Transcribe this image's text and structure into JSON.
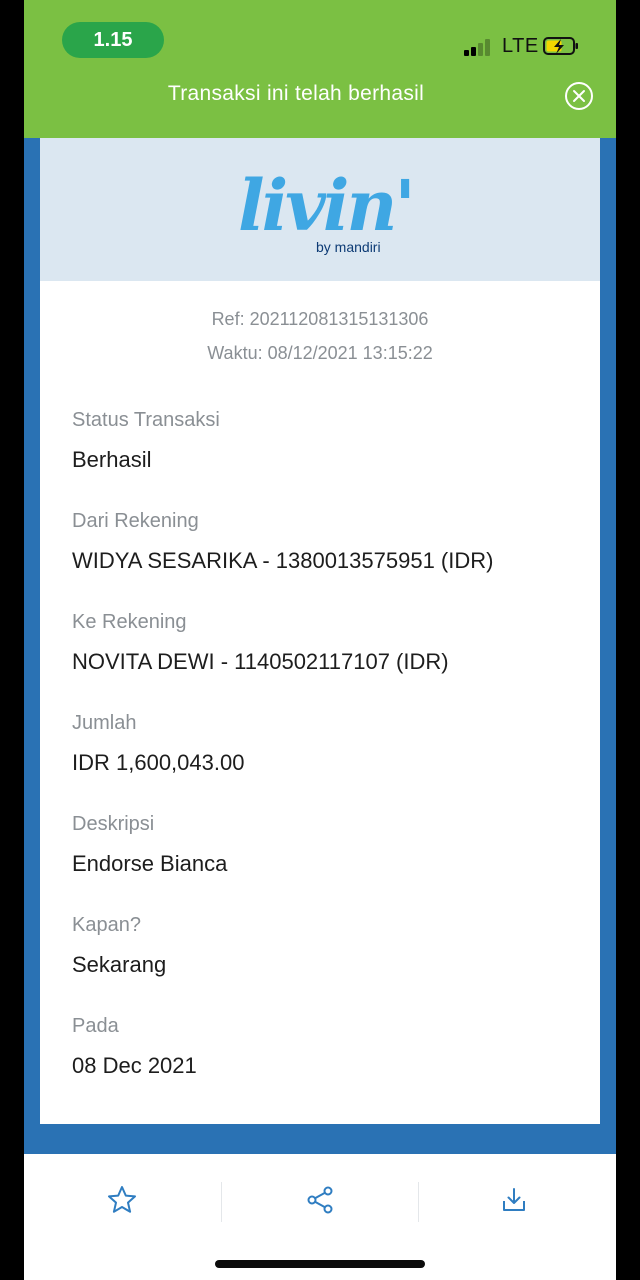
{
  "status_bar": {
    "time": "1.15",
    "network": "LTE",
    "icons": [
      "signal-icon",
      "battery-charging-icon"
    ]
  },
  "header": {
    "title": "Transaksi ini telah berhasil",
    "close_icon": "close-circle-icon"
  },
  "logo": {
    "brand": "livin'",
    "sub": "by mandiri",
    "colors": {
      "brand_blue": "#3fa7e3",
      "accent_yellow": "#f5b800",
      "navy": "#0d3b75"
    }
  },
  "receipt": {
    "ref": "Ref: 20211208131513130​6",
    "time": "Waktu: 08/12/2021 13:15:22",
    "fields": [
      {
        "label": "Status Transaksi",
        "value": "Berhasil"
      },
      {
        "label": "Dari Rekening",
        "value": "WIDYA SESARIKA - 1380013575951 (IDR)"
      },
      {
        "label": "Ke Rekening",
        "value": "NOVITA DEWI - 1140502117107 (IDR)"
      },
      {
        "label": "Jumlah",
        "value": "IDR 1,600,043.00"
      },
      {
        "label": "Deskripsi",
        "value": "Endorse Bianca"
      },
      {
        "label": "Kapan?",
        "value": "Sekarang"
      },
      {
        "label": "Pada",
        "value": "08 Dec 2021"
      }
    ]
  },
  "actions": [
    {
      "icon": "star-icon"
    },
    {
      "icon": "share-icon"
    },
    {
      "icon": "download-icon"
    }
  ],
  "colors": {
    "header_green": "#7bc043",
    "time_pill_green": "#2aa54a",
    "frame_blue": "#2a72b4",
    "logo_band": "#dbe7f1",
    "icon_blue": "#2f7dc1"
  }
}
